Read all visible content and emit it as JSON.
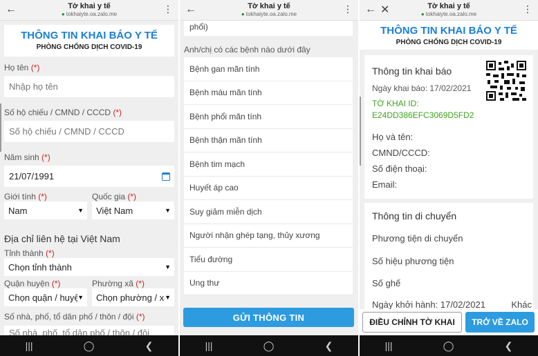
{
  "browser": {
    "page_title": "Tờ khai y tế",
    "url": "tokhaiyte.oa.zalo.me"
  },
  "header": {
    "title": "THÔNG TIN KHAI BÁO Y TẾ",
    "subtitle": "PHÒNG CHỐNG DỊCH COVID-19"
  },
  "required_mark": "(*)",
  "form": {
    "name_label": "Họ tên",
    "name_placeholder": "Nhập họ tên",
    "passport_label": "Số hộ chiếu / CMND / CCCD",
    "passport_placeholder": "Số hộ chiếu / CMND / CCCD",
    "dob_label": "Năm sinh",
    "dob_value": "21/07/1991",
    "gender_label": "Giới tính",
    "gender_value": "Nam",
    "country_label": "Quốc gia",
    "country_value": "Việt Nam",
    "address_heading": "Địa chỉ liên hệ tại Việt Nam",
    "province_label": "Tỉnh thành",
    "province_value": "Chọn tỉnh thành",
    "district_label": "Quận huyện",
    "district_value": "Chọn quận / huyện",
    "ward_label": "Phường xã",
    "ward_value": "Chọn phường / xã",
    "street_label": "Số nhà, phố, tổ dân phố / thôn / đội",
    "street_placeholder": "Số nhà, phố, tổ dân phố / thôn / đội"
  },
  "diseases": {
    "prev_fragment": "phổi)",
    "question": "Anh/chị có các bệnh nào dưới đây",
    "items": [
      "Bệnh gan mãn tính",
      "Bệnh máu mãn tính",
      "Bệnh phổi mãn tính",
      "Bệnh thận mãn tính",
      "Bệnh tim mạch",
      "Huyết áp cao",
      "Suy giảm miễn dịch",
      "Người nhận ghép tạng, thủy xương",
      "Tiểu đường",
      "Ung thư"
    ],
    "submit_label": "GỬI THÔNG TIN"
  },
  "summary": {
    "card_title": "Thông tin khai báo",
    "date_line": "Ngày khai báo: 17/02/2021",
    "id_label": "TỜ KHAI ID:",
    "id_value": "E24DD386EFC3069D5FD2",
    "fullname_label": "Họ và tên:",
    "idcard_label": "CMND/CCCD:",
    "phone_label": "Số điện thoại:",
    "email_label": "Email:",
    "travel_title": "Thông tin di chuyển",
    "transport_label": "Phương tiện di chuyển",
    "vehicle_no_label": "Số hiệu phương tiện",
    "seat_label": "Số ghế",
    "depart_line": "Ngày khởi hành: 17/02/2021",
    "other_fragment": "Khác",
    "edit_button": "ĐIỀU CHỈNH TỜ KHAI",
    "back_button": "TRỞ VỀ ZALO"
  },
  "icons": {
    "back": "arrow-left-icon",
    "close": "close-icon",
    "menu": "more-vertical-icon",
    "lock": "lock-icon",
    "calendar": "calendar-icon",
    "qr": "qr-code-icon",
    "nav_recents": "recents-icon",
    "nav_home": "home-icon",
    "nav_back": "nav-back-icon"
  },
  "colors": {
    "accent_blue": "#1a7fd6",
    "button_blue": "#2d9be0",
    "required_red": "#d32020",
    "id_green": "#3fa21f"
  }
}
